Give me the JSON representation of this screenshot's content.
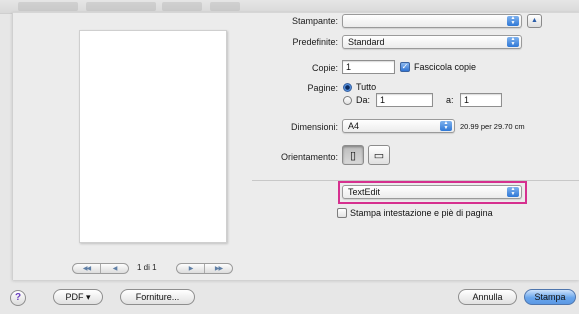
{
  "printer": {
    "label": "Stampante:",
    "value": ""
  },
  "presets": {
    "label": "Predefinite:",
    "value": "Standard"
  },
  "copies": {
    "label": "Copie:",
    "value": "1",
    "collate_label": "Fascicola copie",
    "collate_checked": true
  },
  "pages": {
    "label": "Pagine:",
    "all_label": "Tutto",
    "range_label": "Da:",
    "from_value": "1",
    "to_label": "a:",
    "to_value": "1",
    "selected": "all"
  },
  "size": {
    "label": "Dimensioni:",
    "value": "A4",
    "dimensions": "20.99 per 29.70 cm"
  },
  "orientation": {
    "label": "Orientamento:",
    "selected": "portrait"
  },
  "panel_popup": {
    "value": "TextEdit"
  },
  "header_footer": {
    "label": "Stampa intestazione e piè di pagina",
    "checked": false
  },
  "preview": {
    "page_count": "1 di 1"
  },
  "bottom": {
    "help": "?",
    "pdf_label": "PDF ▾",
    "supplies_label": "Forniture...",
    "cancel_label": "Annulla",
    "print_label": "Stampa"
  },
  "colors": {
    "accent": "#2f78d6",
    "highlight_box": "#d6308f"
  }
}
